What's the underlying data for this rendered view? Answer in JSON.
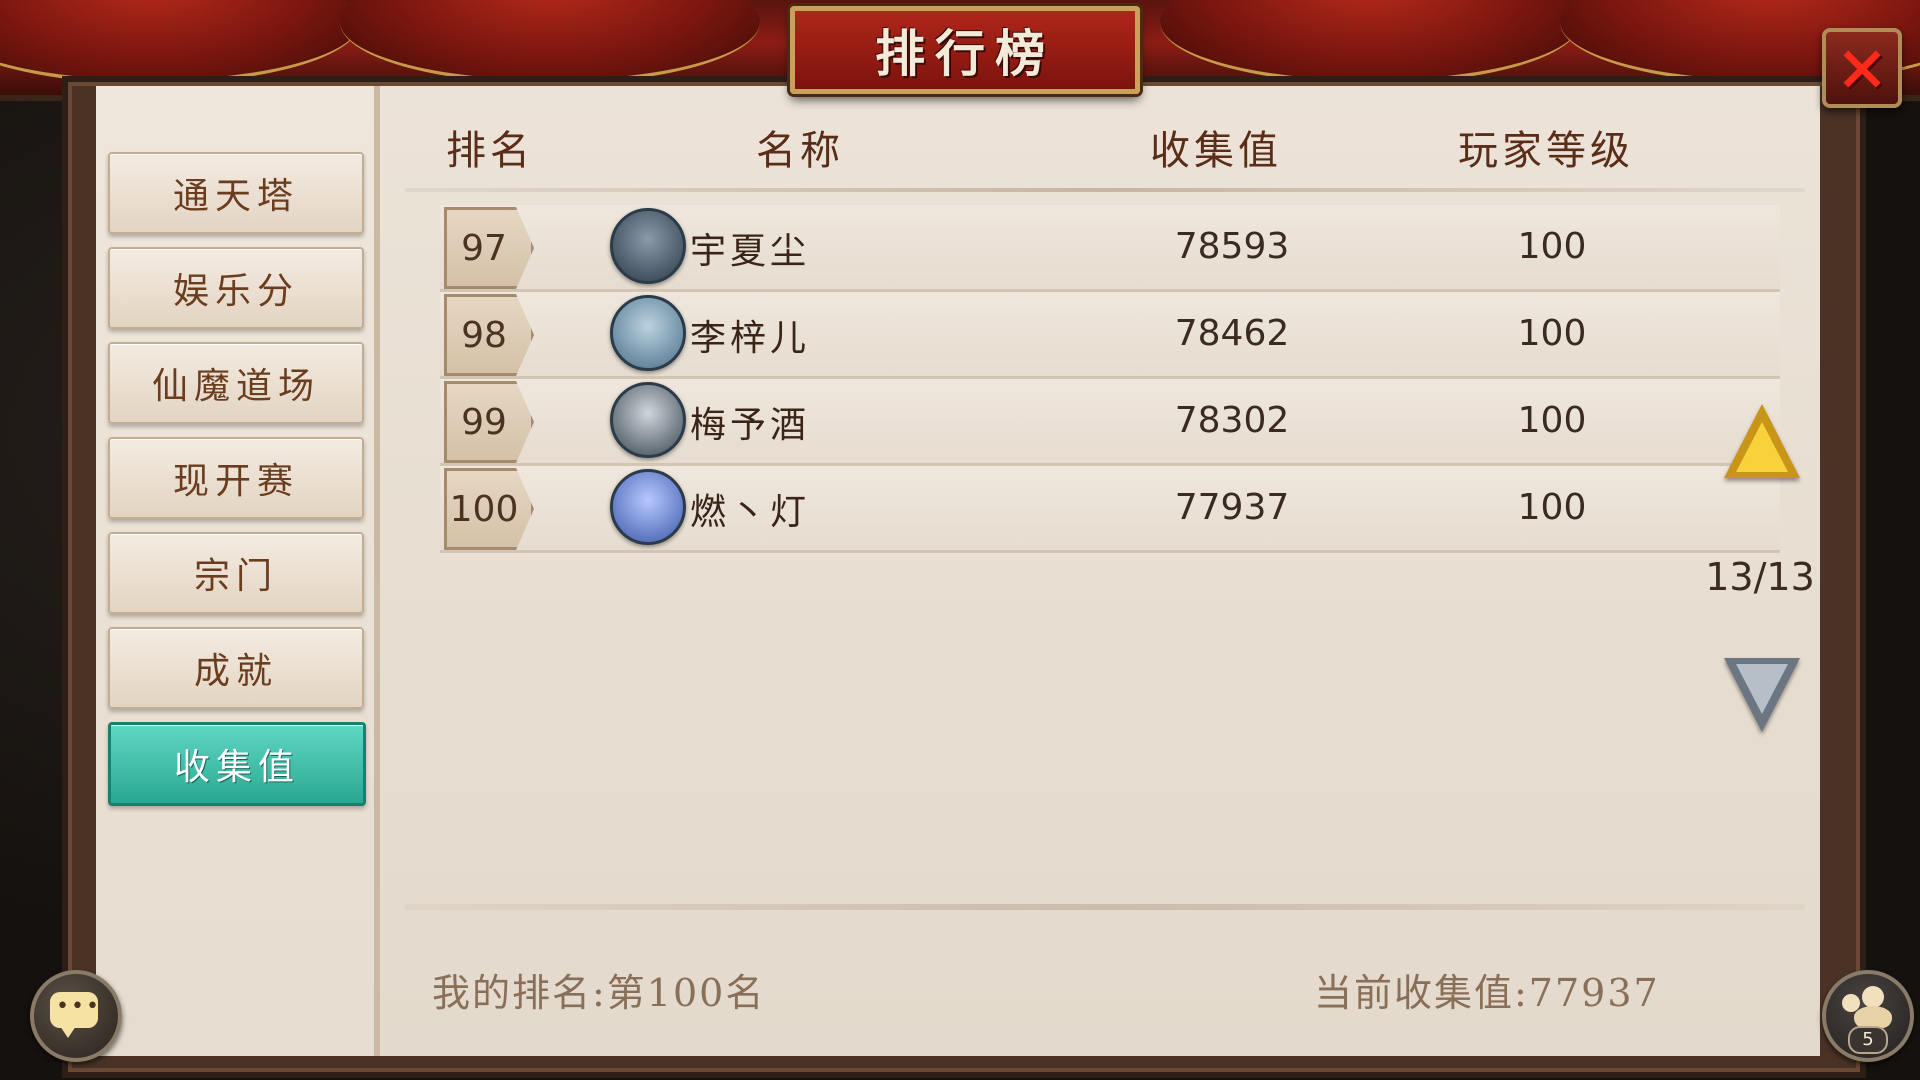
{
  "title": "排行榜",
  "close_icon": "×",
  "sidebar": {
    "items": [
      {
        "label": "通天塔",
        "active": false
      },
      {
        "label": "娱乐分",
        "active": false
      },
      {
        "label": "仙魔道场",
        "active": false
      },
      {
        "label": "现开赛",
        "active": false
      },
      {
        "label": "宗门",
        "active": false
      },
      {
        "label": "成就",
        "active": false
      },
      {
        "label": "收集值",
        "active": true
      }
    ]
  },
  "table": {
    "headers": [
      "排名",
      "名称",
      "收集值",
      "玩家等级"
    ],
    "rows": [
      {
        "rank": "97",
        "name": "宇夏尘",
        "value": "78593",
        "level": "100",
        "avatar_color": "#2c3a48"
      },
      {
        "rank": "98",
        "name": "李梓儿",
        "value": "78462",
        "level": "100",
        "avatar_color": "#4a6f88"
      },
      {
        "rank": "99",
        "name": "梅予酒",
        "value": "78302",
        "level": "100",
        "avatar_color": "#3a4650"
      },
      {
        "rank": "100",
        "name": "燃丶灯",
        "value": "77937",
        "level": "100",
        "avatar_color": "#3a58a8"
      }
    ]
  },
  "pagination": {
    "indicator": "13/13"
  },
  "footer": {
    "my_rank": "我的排名:第100名",
    "current_value": "当前收集值:77937"
  },
  "chat": {
    "dots": "•••"
  },
  "friends": {
    "count": "5"
  },
  "colors": {
    "accent_active": "#2aa792",
    "title_red": "#9a1c12",
    "text_brown": "#5a2d18"
  }
}
